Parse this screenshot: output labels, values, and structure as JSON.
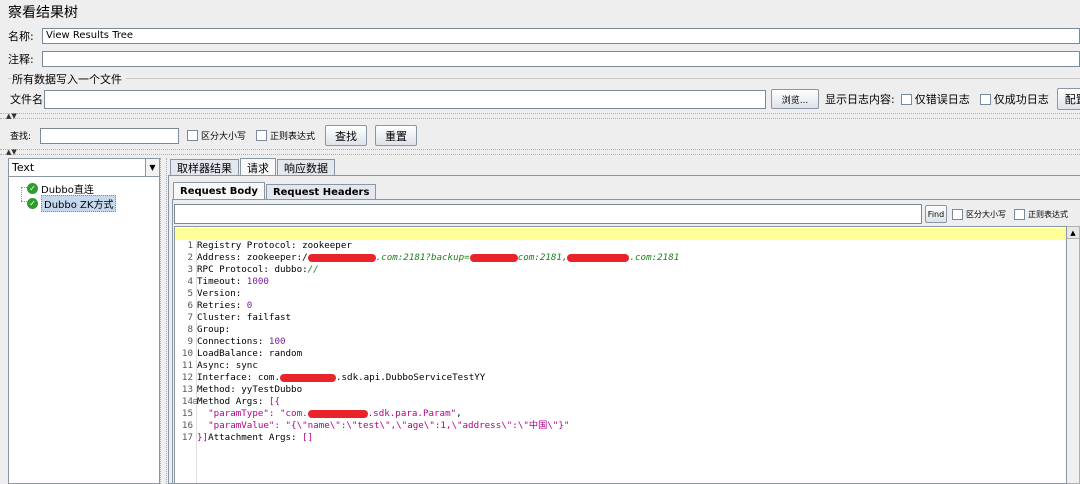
{
  "window": {
    "title": "察看结果树"
  },
  "name_field": {
    "label": "名称:",
    "value": "View Results Tree"
  },
  "comment_field": {
    "label": "注释:",
    "value": ""
  },
  "file_group": {
    "title": "所有数据写入一个文件",
    "file_label": "文件名",
    "file_value": "",
    "browse_label": "浏览...",
    "log_label": "显示日志内容:",
    "errors_only": "仅错误日志",
    "success_only": "仅成功日志",
    "config_label": "配置"
  },
  "search": {
    "label": "查找:",
    "value": "",
    "case_label": "区分大小写",
    "regex_label": "正则表达式",
    "find_label": "查找",
    "reset_label": "重置"
  },
  "tree": {
    "renderer": "Text",
    "items": [
      {
        "label": "Dubbo直连",
        "status": "success"
      },
      {
        "label": "Dubbo ZK方式",
        "status": "success",
        "selected": true
      }
    ]
  },
  "tabs": [
    "取样器结果",
    "请求",
    "响应数据"
  ],
  "subtabs": [
    "Request Body",
    "Request Headers"
  ],
  "body_search": {
    "find_label": "Find",
    "case_label": "区分大小写",
    "regex_label": "正则表达式"
  },
  "code": {
    "l1": "Registry Protocol: zookeeper",
    "l2a": "Address: zookeeper:/",
    "l2b": ".com:2181?backup=",
    "l2c": "com:2181,",
    "l2d": ".com:2181",
    "l3a": "RPC Protocol: dubbo:",
    "l3b": "//",
    "l4a": "Timeout: ",
    "l4b": "1000",
    "l5": "Version:",
    "l6a": "Retries: ",
    "l6b": "0",
    "l7": "Cluster: failfast",
    "l8": "Group:",
    "l9a": "Connections: ",
    "l9b": "100",
    "l10": "LoadBalance: random",
    "l11": "Async: sync",
    "l12a": "Interface: com.",
    "l12b": ".sdk.api.DubboServiceTestYY",
    "l13": "Method: yyTestDubbo",
    "l14a": "Method Args: ",
    "l14b": "[{",
    "l15a": "  \"paramType\": \"com.",
    "l15b": ".sdk.para.Param\"",
    "l15c": ",",
    "l16a": "  \"paramValue\": ",
    "l16b": "\"{\\\"name\\\":\\\"test\\\",\\\"age\\\":1,\\\"address\\\":\\\"中国\\\"}\"",
    "l17a": "}]",
    "l17b": "Attachment Args: ",
    "l17c": "[]"
  }
}
